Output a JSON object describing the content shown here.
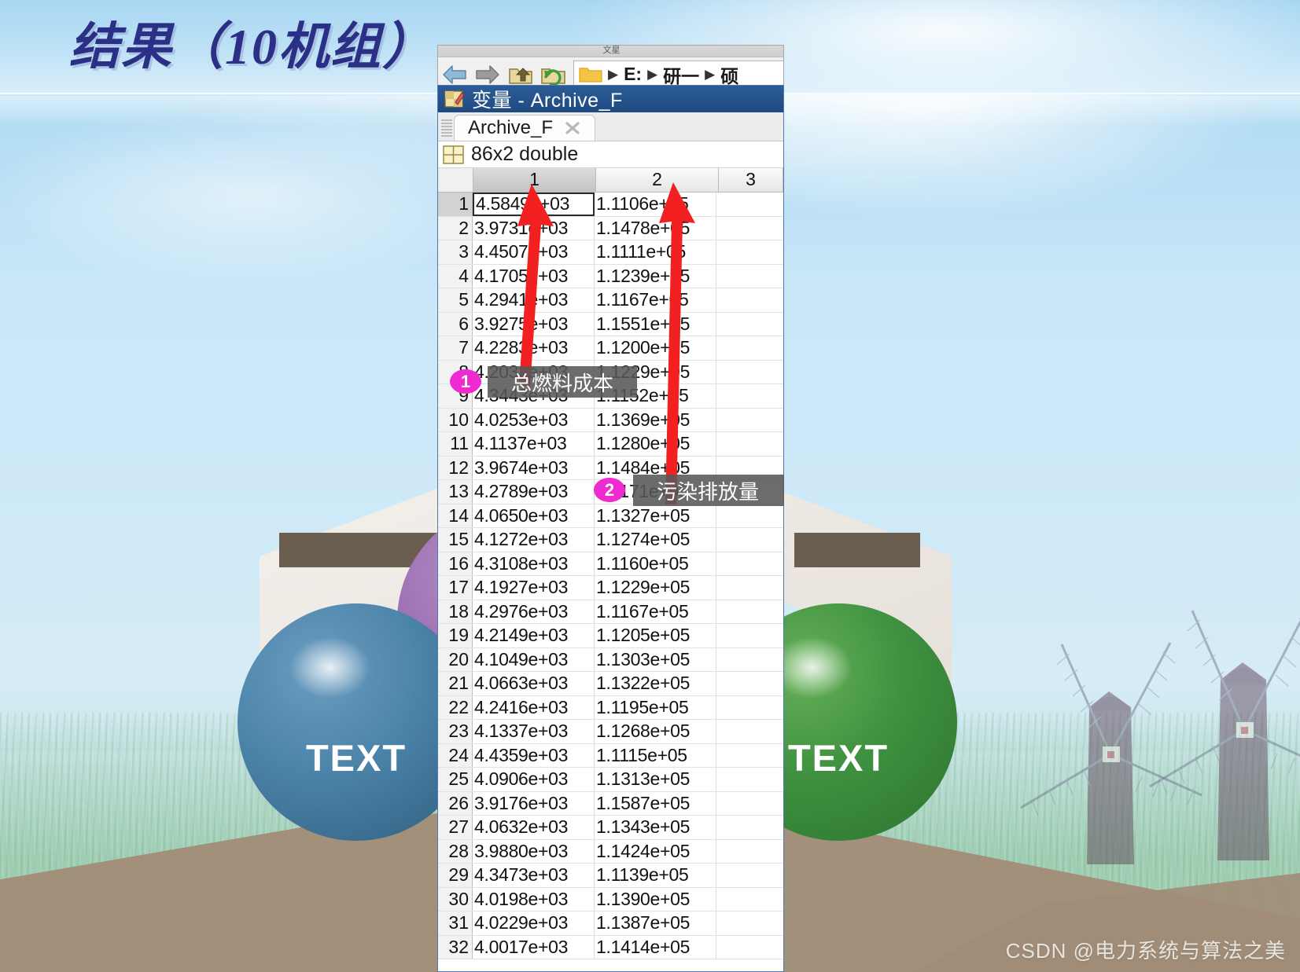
{
  "slide": {
    "title": "结果（10机组）",
    "sphere_labels": [
      "TEXT",
      "TEXT"
    ],
    "watermark": "CSDN @电力系统与算法之美"
  },
  "explorer": {
    "window_caption": "文星",
    "back_icon": "back-arrow-icon",
    "forward_icon": "forward-arrow-icon",
    "up_icon": "up-folder-icon",
    "refresh_icon": "refresh-icon",
    "folder_icon": "folder-icon",
    "breadcrumbs": [
      "E:",
      "研一",
      "硕"
    ],
    "separator": "▶"
  },
  "variable_editor": {
    "title": "变量 - Archive_F",
    "title_icon": "variable-editor-icon",
    "tab": {
      "label": "Archive_F",
      "close_icon": "close-icon"
    },
    "summary": "86x2 double",
    "summary_icon": "matrix-icon",
    "columns": [
      "1",
      "2",
      "3"
    ],
    "selected_column": "1",
    "selected_cell": "r1c1"
  },
  "annotations": [
    {
      "badge": "1",
      "label": "总燃料成本",
      "target_column": "1"
    },
    {
      "badge": "2",
      "label": "污染排放量",
      "target_column": "2"
    }
  ],
  "chart_data": {
    "type": "table",
    "title": "Archive_F — 86x2 double",
    "columns": [
      "1",
      "2"
    ],
    "column_meanings": [
      "总燃料成本",
      "污染排放量"
    ],
    "row_labels": [
      "1",
      "2",
      "3",
      "4",
      "5",
      "6",
      "7",
      "8",
      "9",
      "10",
      "11",
      "12",
      "13",
      "14",
      "15",
      "16",
      "17",
      "18",
      "19",
      "20",
      "21",
      "22",
      "23",
      "24",
      "25",
      "26",
      "27",
      "28",
      "29",
      "30",
      "31",
      "32"
    ],
    "rows": [
      [
        "4.5849e+03",
        "1.1106e+05"
      ],
      [
        "3.9731e+03",
        "1.1478e+05"
      ],
      [
        "4.4507e+03",
        "1.1111e+05"
      ],
      [
        "4.1705e+03",
        "1.1239e+05"
      ],
      [
        "4.2941e+03",
        "1.1167e+05"
      ],
      [
        "3.9275e+03",
        "1.1551e+05"
      ],
      [
        "4.2283e+03",
        "1.1200e+05"
      ],
      [
        "4.2032e+03",
        "1.1229e+05"
      ],
      [
        "4.3443e+03",
        "1.1152e+05"
      ],
      [
        "4.0253e+03",
        "1.1369e+05"
      ],
      [
        "4.1137e+03",
        "1.1280e+05"
      ],
      [
        "3.9674e+03",
        "1.1484e+05"
      ],
      [
        "4.2789e+03",
        "1.1171e+05"
      ],
      [
        "4.0650e+03",
        "1.1327e+05"
      ],
      [
        "4.1272e+03",
        "1.1274e+05"
      ],
      [
        "4.3108e+03",
        "1.1160e+05"
      ],
      [
        "4.1927e+03",
        "1.1229e+05"
      ],
      [
        "4.2976e+03",
        "1.1167e+05"
      ],
      [
        "4.2149e+03",
        "1.1205e+05"
      ],
      [
        "4.1049e+03",
        "1.1303e+05"
      ],
      [
        "4.0663e+03",
        "1.1322e+05"
      ],
      [
        "4.2416e+03",
        "1.1195e+05"
      ],
      [
        "4.1337e+03",
        "1.1268e+05"
      ],
      [
        "4.4359e+03",
        "1.1115e+05"
      ],
      [
        "4.0906e+03",
        "1.1313e+05"
      ],
      [
        "3.9176e+03",
        "1.1587e+05"
      ],
      [
        "4.0632e+03",
        "1.1343e+05"
      ],
      [
        "3.9880e+03",
        "1.1424e+05"
      ],
      [
        "4.3473e+03",
        "1.1139e+05"
      ],
      [
        "4.0198e+03",
        "1.1390e+05"
      ],
      [
        "4.0229e+03",
        "1.1387e+05"
      ],
      [
        "4.0017e+03",
        "1.1414e+05"
      ]
    ],
    "total_rows": 86,
    "total_cols": 2,
    "xlabel": "",
    "ylabel": ""
  },
  "colors": {
    "title_blue": "#2b2f86",
    "titlebar_blue": "#1e4a81",
    "badge_magenta": "#ef2ad0",
    "arrow_red": "#f22020",
    "callout_gray": "#585858"
  }
}
